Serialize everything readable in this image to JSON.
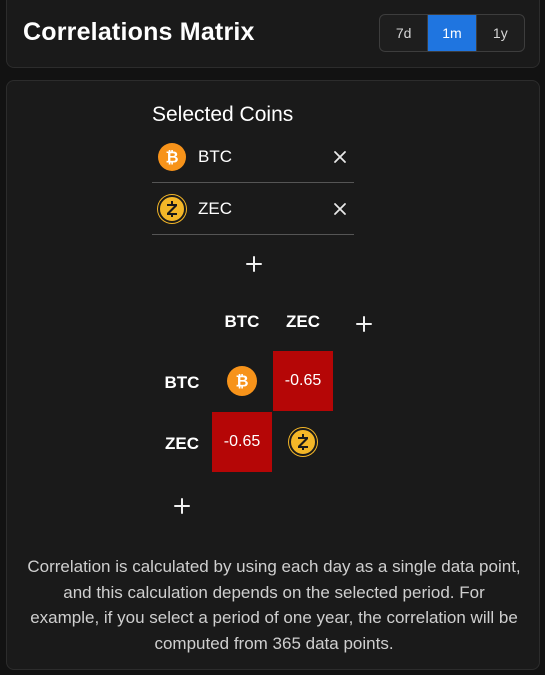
{
  "header": {
    "title": "Correlations Matrix",
    "periods": [
      {
        "label": "7d",
        "active": false
      },
      {
        "label": "1m",
        "active": true
      },
      {
        "label": "1y",
        "active": false
      }
    ]
  },
  "selected_coins": {
    "title": "Selected Coins",
    "coins": [
      {
        "symbol": "BTC",
        "icon": "bitcoin-icon",
        "color": "#f7931a"
      },
      {
        "symbol": "ZEC",
        "icon": "zcash-icon",
        "color": "#f4b728"
      }
    ],
    "add_icon": "plus-icon",
    "remove_icon": "close-icon"
  },
  "matrix": {
    "columns": [
      "BTC",
      "ZEC"
    ],
    "rows": [
      "BTC",
      "ZEC"
    ],
    "cells": [
      [
        null,
        "-0.65"
      ],
      [
        "-0.65",
        null
      ]
    ],
    "cell_color": "#b50606"
  },
  "footnote": "Correlation is calculated by using each day as a single data point, and this calculation depends on the selected period. For example, if you select a period of one year, the correlation will be computed from 365 data points."
}
